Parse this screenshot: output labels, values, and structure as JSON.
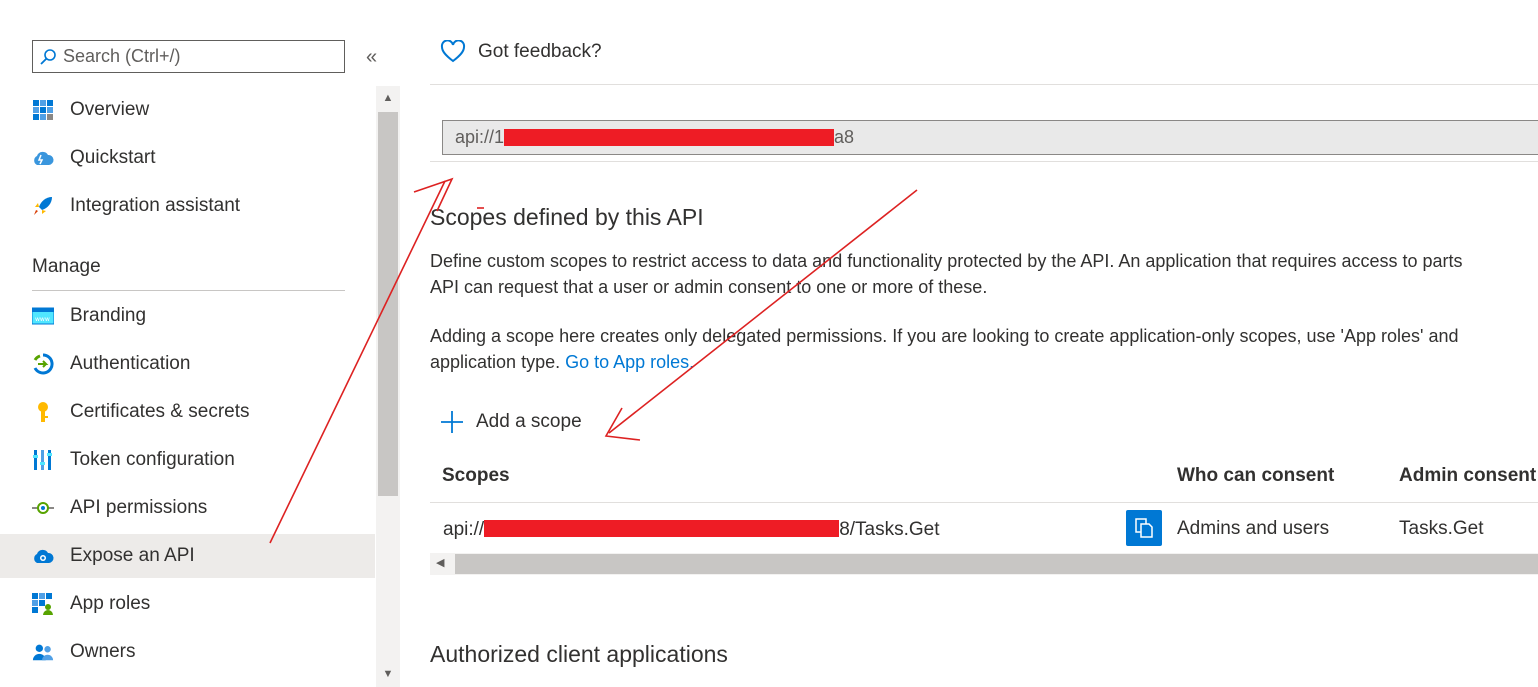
{
  "sidebar": {
    "search_placeholder": "Search (Ctrl+/)",
    "collapse_icon": "«",
    "items_top": [
      {
        "label": "Overview",
        "icon": "overview-grid-icon"
      },
      {
        "label": "Quickstart",
        "icon": "quickstart-cloud-icon"
      },
      {
        "label": "Integration assistant",
        "icon": "rocket-icon"
      }
    ],
    "section_label": "Manage",
    "items_manage": [
      {
        "label": "Branding",
        "icon": "branding-icon"
      },
      {
        "label": "Authentication",
        "icon": "authentication-icon"
      },
      {
        "label": "Certificates & secrets",
        "icon": "key-icon"
      },
      {
        "label": "Token configuration",
        "icon": "token-bars-icon"
      },
      {
        "label": "API permissions",
        "icon": "api-permissions-icon"
      },
      {
        "label": "Expose an API",
        "icon": "expose-api-cloud-icon",
        "selected": true
      },
      {
        "label": "App roles",
        "icon": "app-roles-icon"
      },
      {
        "label": "Owners",
        "icon": "owners-icon"
      }
    ]
  },
  "main": {
    "feedback_label": "Got feedback?",
    "app_id_uri": {
      "prefix": "api://1",
      "suffix": "a8"
    },
    "scopes_heading": "Scopes defined by this API",
    "para1_line1": "Define custom scopes to restrict access to data and functionality protected by the API. An application that requires access to parts",
    "para1_line2": "API can request that a user or admin consent to one or more of these.",
    "para2_line1": "Adding a scope here creates only delegated permissions. If you are looking to create application-only scopes, use 'App roles' and",
    "para2_line2": "application type.",
    "go_to_app_roles": "Go to App roles.",
    "add_scope_label": "Add a scope",
    "table": {
      "headers": [
        "Scopes",
        "Who can consent",
        "Admin consent"
      ],
      "row": {
        "scope_prefix": "api://",
        "scope_suffix": "8/Tasks.Get",
        "who_can_consent": "Admins and users",
        "admin_consent": "Tasks.Get"
      }
    },
    "authorized_heading": "Authorized client applications"
  },
  "colors": {
    "accent": "#0078d4",
    "redaction": "#ee1c25",
    "annotation": "#dd2222",
    "selected_bg": "#edebe9"
  }
}
